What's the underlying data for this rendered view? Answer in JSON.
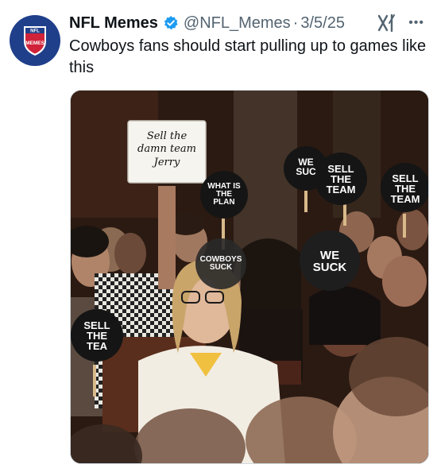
{
  "tweet": {
    "display_name": "NFL Memes",
    "handle": "@NFL_Memes",
    "separator": "·",
    "date": "3/5/25",
    "text": "Cowboys fans should start pulling up to games like this",
    "more_label": "•••"
  },
  "avatar": {
    "logo_text": "NFL",
    "logo_subtext": "MEMES"
  },
  "photo": {
    "whiteboard": "Sell the damn team Jerry",
    "sign_what_is_the_plan": "WHAT IS THE PLAN",
    "sign_we_suck_top": "WE SUC",
    "sign_sell_team_1": "SELL THE TEAM",
    "sign_sell_team_2": "SELL THE TEAM",
    "sign_cowboys": "COWBOYS SUCK",
    "sign_we_suck": "WE SUCK",
    "sign_sell_team_left": "SELL THE TEA"
  },
  "colors": {
    "verified": "#1d9bf0",
    "avatar_bg": "#1f3f8a",
    "text_secondary": "#536471"
  }
}
